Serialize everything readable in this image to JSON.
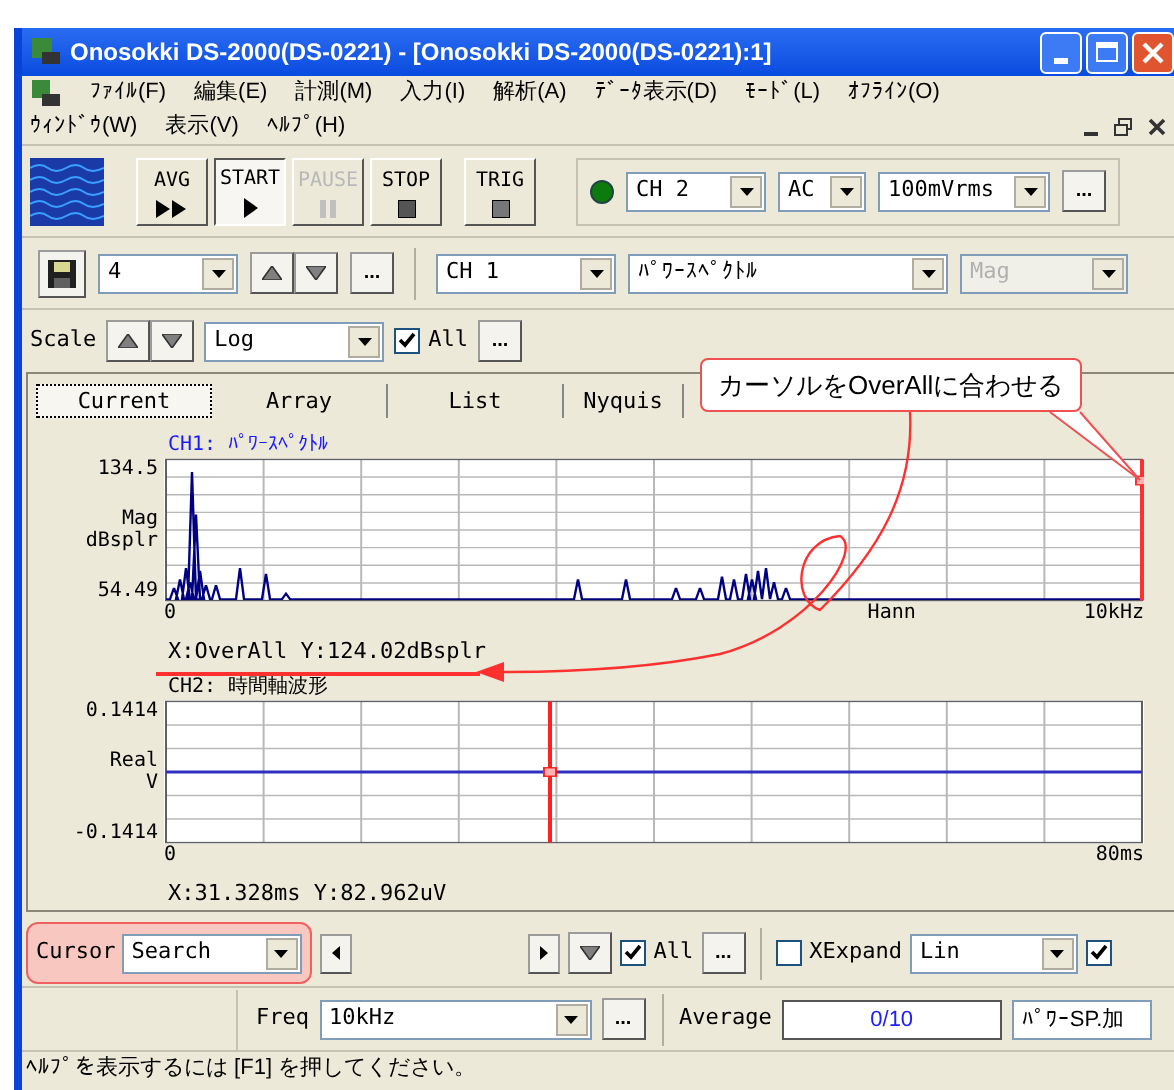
{
  "window": {
    "title": "Onosokki DS-2000(DS-0221) - [Onosokki DS-2000(DS-0221):1]"
  },
  "menu_rows": [
    [
      "ﾌｧｲﾙ(F)",
      "編集(E)",
      "計測(M)",
      "入力(I)",
      "解析(A)",
      "ﾃﾞｰﾀ表示(D)",
      "ﾓｰﾄﾞ(L)",
      "ｵﾌﾗｲﾝ(O)"
    ],
    [
      "ｳｨﾝﾄﾞｳ(W)",
      "表示(V)",
      "ﾍﾙﾌﾟ(H)"
    ]
  ],
  "toolbar": {
    "buttons": [
      {
        "label": "AVG",
        "kind": "avg",
        "pressed": false,
        "disabled": false
      },
      {
        "label": "START",
        "kind": "start",
        "pressed": true,
        "disabled": false
      },
      {
        "label": "PAUSE",
        "kind": "pause",
        "pressed": false,
        "disabled": true
      },
      {
        "label": "STOP",
        "kind": "stop",
        "pressed": false,
        "disabled": false
      },
      {
        "label": "TRIG",
        "kind": "trig",
        "pressed": false,
        "disabled": false
      }
    ],
    "channel": "CH 2",
    "coupling": "AC",
    "range": "100mVrms",
    "more": "..."
  },
  "display_bar": {
    "slot": "4",
    "more": "...",
    "channel": "CH 1",
    "function": "ﾊﾟﾜｰｽﾍﾟｸﾄﾙ",
    "mode": {
      "value": "Mag",
      "disabled": true
    }
  },
  "scale_bar": {
    "label": "Scale",
    "type": "Log",
    "all": {
      "label": "All",
      "checked": true
    },
    "more": "..."
  },
  "tabs": [
    {
      "label": "Current",
      "selected": true
    },
    {
      "label": "Array",
      "selected": false
    },
    {
      "label": "List",
      "selected": false
    },
    {
      "label": "Nyquis",
      "selected": false
    }
  ],
  "charts": [
    {
      "title": "CH1: ﾊﾟﾜｰｽﾍﾟｸﾄﾙ",
      "kind": "spectrum",
      "y_max": "134.5",
      "y_min": "54.49",
      "y_label": [
        "Mag",
        "dBsplr"
      ],
      "x_min": "0",
      "x_note": "Hann",
      "x_max": "10kHz",
      "readout": "X:OverAll Y:124.02dBsplr"
    },
    {
      "title": "CH2: 時間軸波形",
      "kind": "time",
      "y_max": "0.1414",
      "y_min": "-0.1414",
      "y_label": [
        "Real",
        "V"
      ],
      "x_min": "0",
      "x_max": "80ms",
      "readout": "X:31.328ms Y:82.962uV"
    }
  ],
  "callout": "カーソルをOverAllに合わせる",
  "cursor_bar": {
    "label": "Cursor",
    "mode": "Search",
    "all": {
      "label": "All",
      "checked": true
    },
    "more": "...",
    "xexpand": {
      "label": "XExpand",
      "checked": false
    },
    "scale": "Lin",
    "extra": {
      "checked": true
    }
  },
  "freq_bar": {
    "label": "Freq",
    "value": "10kHz",
    "more": "...",
    "average_label": "Average",
    "average": "0/10",
    "mode": "ﾊﾟﾜｰSP.加"
  },
  "status_bar": "ﾍﾙﾌﾟを表示するには [F1] を押してください。"
}
